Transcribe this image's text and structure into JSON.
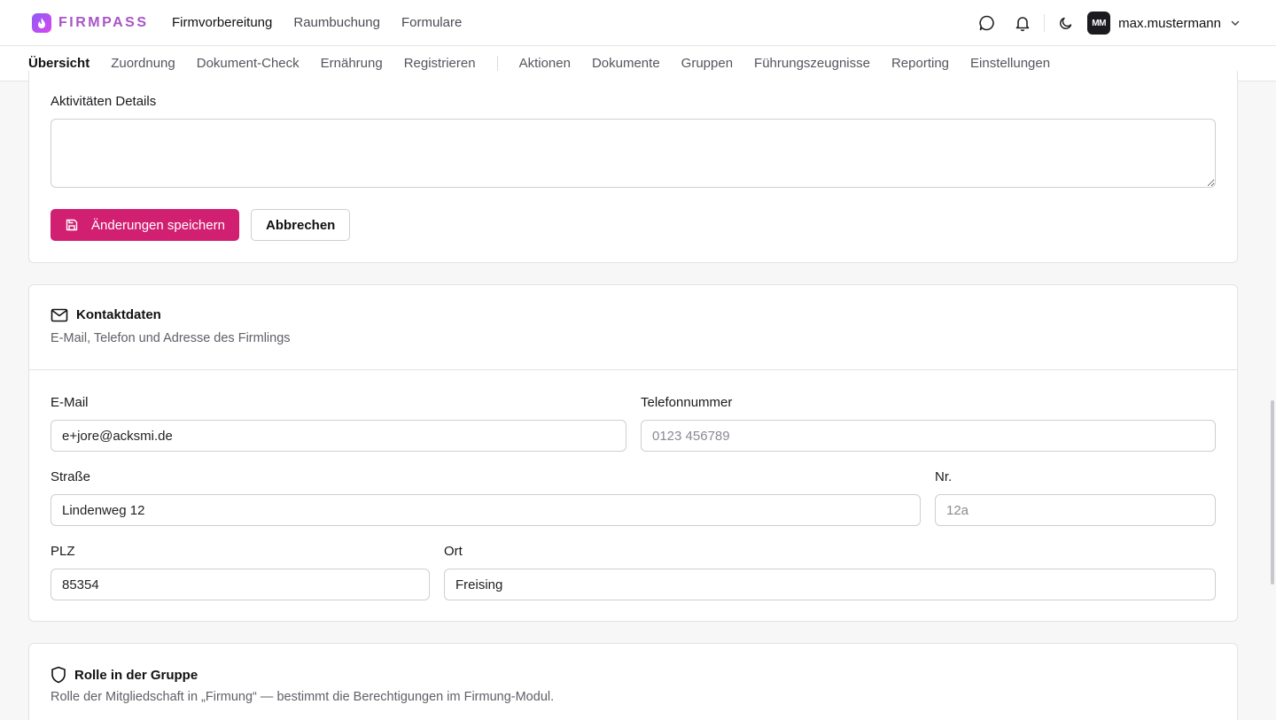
{
  "app": {
    "brand": "FIRMPASS",
    "topnav": [
      "Firmvorbereitung",
      "Raumbuchung",
      "Formulare"
    ],
    "user": {
      "initials": "MM",
      "name": "max.mustermann"
    }
  },
  "subnav": {
    "left": [
      "Übersicht",
      "Zuordnung",
      "Dokument-Check",
      "Ernährung",
      "Registrieren"
    ],
    "right": [
      "Aktionen",
      "Dokumente",
      "Gruppen",
      "Führungszeugnisse",
      "Reporting",
      "Einstellungen"
    ]
  },
  "activities": {
    "label": "Aktivitäten Details",
    "value": "",
    "save_label": "Änderungen speichern",
    "cancel_label": "Abbrechen"
  },
  "contact": {
    "title": "Kontaktdaten",
    "subtitle": "E-Mail, Telefon und Adresse des Firmlings",
    "email": {
      "label": "E-Mail",
      "value": "e+jore@acksmi.de",
      "placeholder": ""
    },
    "phone": {
      "label": "Telefonnummer",
      "value": "",
      "placeholder": "0123 456789"
    },
    "street": {
      "label": "Straße",
      "value": "Lindenweg 12",
      "placeholder": ""
    },
    "number": {
      "label": "Nr.",
      "value": "",
      "placeholder": "12a"
    },
    "zip": {
      "label": "PLZ",
      "value": "85354",
      "placeholder": ""
    },
    "city": {
      "label": "Ort",
      "value": "Freising",
      "placeholder": ""
    }
  },
  "role": {
    "title": "Rolle in der Gruppe",
    "subtitle": "Rolle der Mitgliedschaft in „Firmung“ — bestimmt die Berechtigungen im Firmung-Modul."
  },
  "colors": {
    "primary": "#d11f72",
    "brand": "#a855c7"
  },
  "icons": [
    "flame-logo-icon",
    "chat-bubble-icon",
    "bell-icon",
    "moon-icon",
    "chevron-down-icon",
    "save-icon",
    "mail-icon",
    "shield-icon"
  ]
}
